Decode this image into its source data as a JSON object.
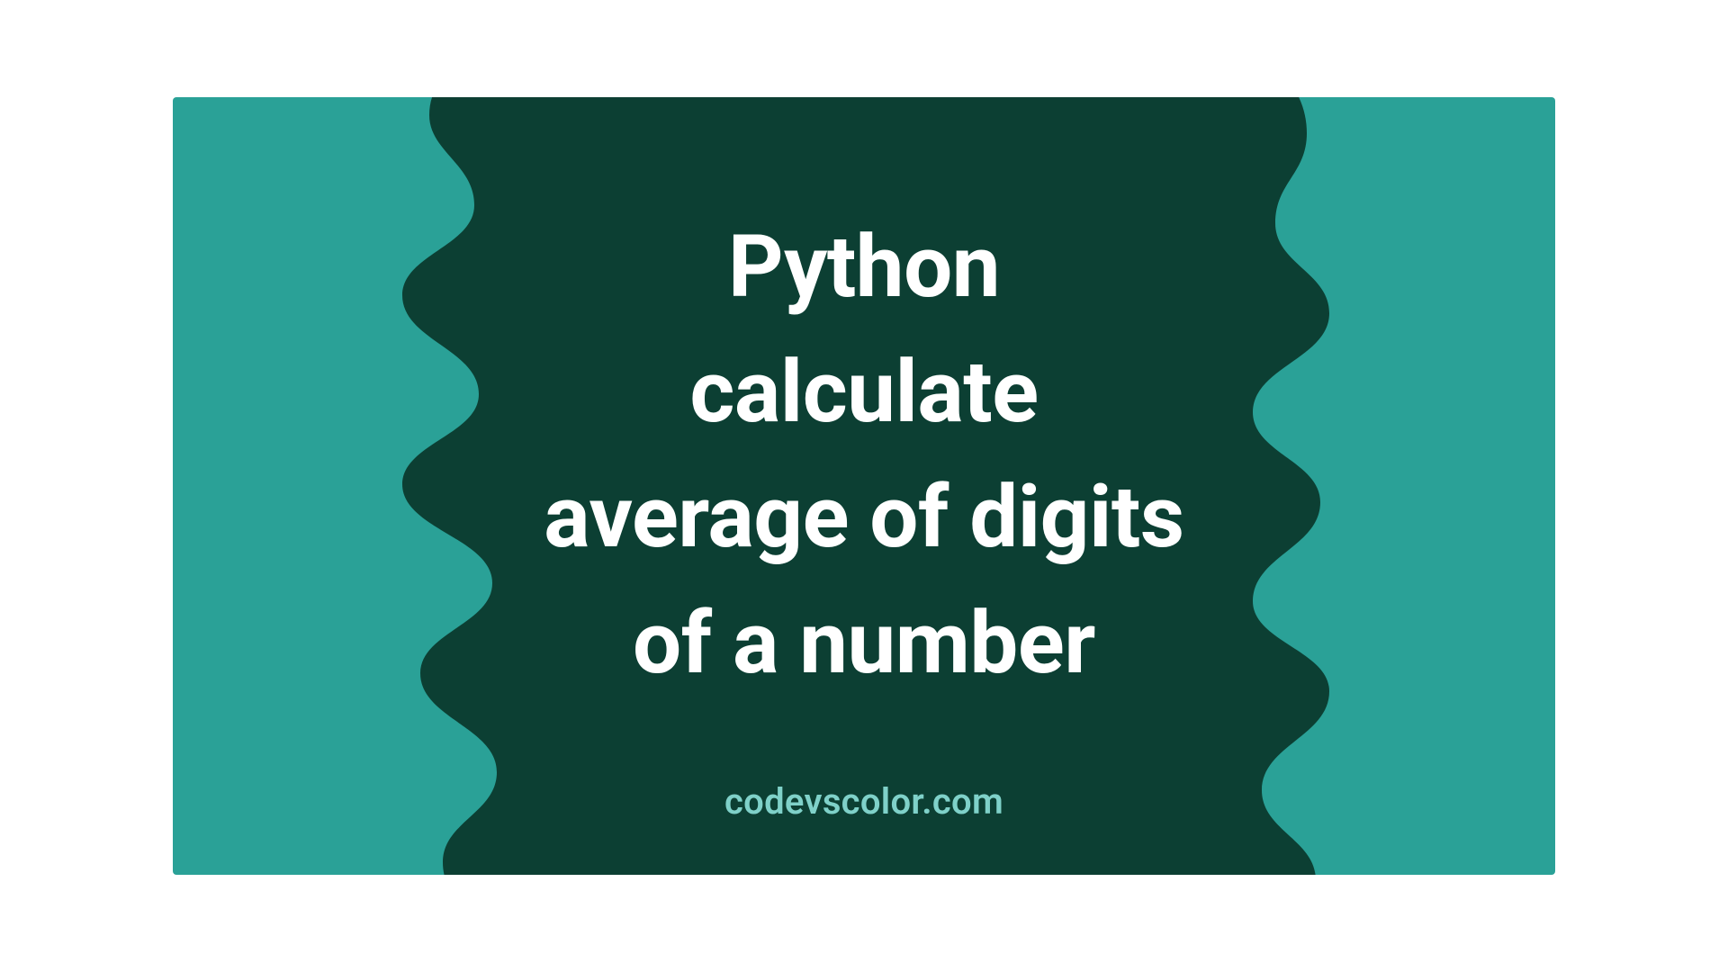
{
  "colors": {
    "bg_outer": "#2aa197",
    "bg_inner": "#0c3f33",
    "text_main": "#ffffff",
    "text_site": "#7fd1c9"
  },
  "main": {
    "title": "Python\ncalculate\naverage of digits\nof a number",
    "site": "codevscolor.com"
  }
}
